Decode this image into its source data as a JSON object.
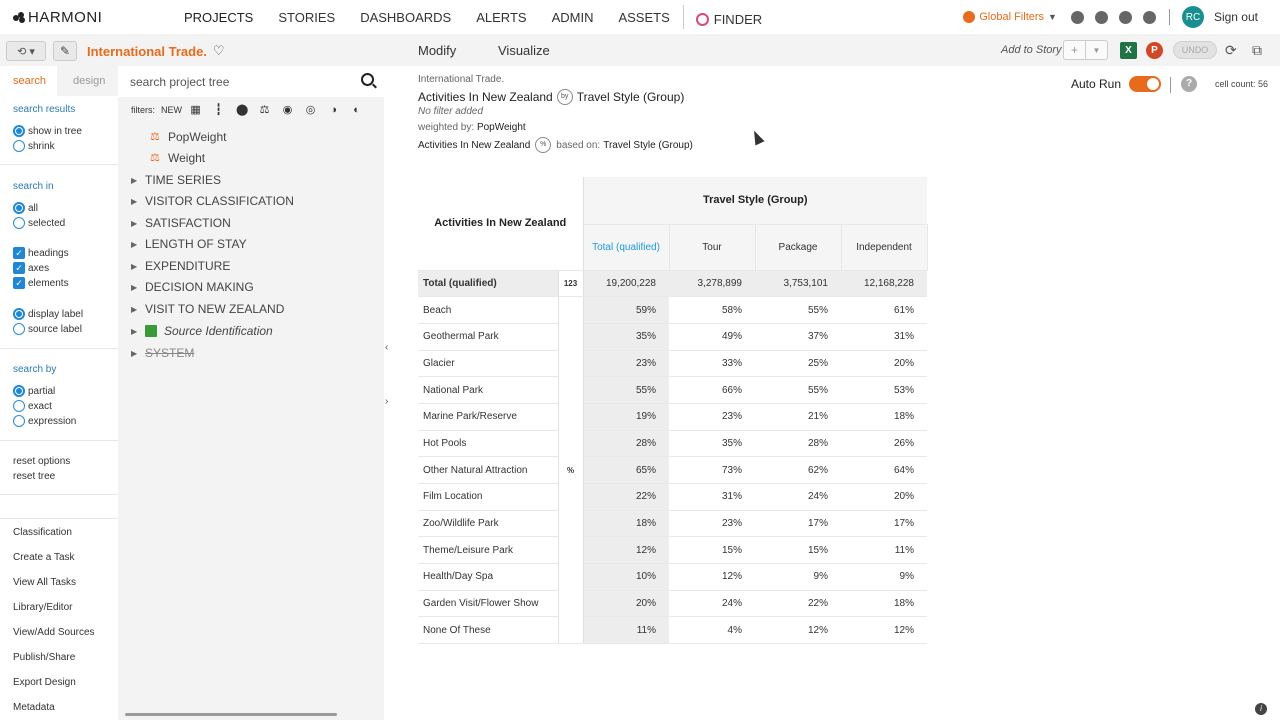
{
  "app": {
    "brand": "HARMONI",
    "nav": [
      "PROJECTS",
      "STORIES",
      "DASHBOARDS",
      "ALERTS",
      "ADMIN",
      "ASSETS"
    ],
    "finder": "FINDER",
    "global_filters": "Global Filters",
    "avatar_initials": "RC",
    "sign_out": "Sign out"
  },
  "subbar": {
    "project_title": "International Trade.",
    "modify": "Modify",
    "visualize": "Visualize",
    "add_to_story": "Add to Story",
    "undo": "UNDO",
    "excel": "X",
    "ppt": "P"
  },
  "left": {
    "tab_search": "search",
    "tab_design": "design",
    "search_results": "search results",
    "show_in_tree": "show in tree",
    "shrink": "shrink",
    "search_in": "search in",
    "all": "all",
    "selected": "selected",
    "headings": "headings",
    "axes": "axes",
    "elements": "elements",
    "display_label": "display label",
    "source_label": "source label",
    "search_by": "search by",
    "partial": "partial",
    "exact": "exact",
    "expression": "expression",
    "reset_options": "reset options",
    "reset_tree": "reset tree",
    "links": [
      "Classification",
      "Create a Task",
      "View All Tasks",
      "Library/Editor",
      "View/Add Sources",
      "Publish/Share",
      "Export Design",
      "Metadata"
    ]
  },
  "tree": {
    "search_placeholder": "search project tree",
    "filters_label": "filters:",
    "new": "NEW",
    "weights": [
      "PopWeight",
      "Weight"
    ],
    "folders": [
      "TIME SERIES",
      "VISITOR CLASSIFICATION",
      "SATISFACTION",
      "LENGTH OF STAY",
      "EXPENDITURE",
      "DECISION MAKING",
      "VISIT TO NEW ZEALAND"
    ],
    "source_identification": "Source Identification",
    "system": "SYSTEM"
  },
  "report": {
    "context": "International Trade.",
    "row_var": "Activities In New Zealand",
    "by": "by",
    "col_var": "Travel Style (Group)",
    "no_filter": "No filter added",
    "weighted_by_label": "weighted by:",
    "weighted_by": "PopWeight",
    "pct_icon": "%",
    "based_on_label": "based on:",
    "based_on": "Travel Style (Group)",
    "auto_run": "Auto Run",
    "help": "?",
    "cell_count": "cell count: 56"
  },
  "table": {
    "corner": "Activities In New Zealand",
    "col_group": "Travel Style (Group)",
    "columns": [
      "Total (qualified)",
      "Tour",
      "Package",
      "Independent"
    ],
    "total_label": "Total (qualified)",
    "total_unit": "123",
    "total_values": [
      "19,200,228",
      "3,278,899",
      "3,753,101",
      "12,168,228"
    ],
    "pct_unit": "%",
    "rows": [
      {
        "label": "Beach",
        "values": [
          "59%",
          "58%",
          "55%",
          "61%"
        ]
      },
      {
        "label": "Geothermal Park",
        "values": [
          "35%",
          "49%",
          "37%",
          "31%"
        ]
      },
      {
        "label": "Glacier",
        "values": [
          "23%",
          "33%",
          "25%",
          "20%"
        ]
      },
      {
        "label": "National Park",
        "values": [
          "55%",
          "66%",
          "55%",
          "53%"
        ]
      },
      {
        "label": "Marine Park/Reserve",
        "values": [
          "19%",
          "23%",
          "21%",
          "18%"
        ]
      },
      {
        "label": "Hot Pools",
        "values": [
          "28%",
          "35%",
          "28%",
          "26%"
        ]
      },
      {
        "label": "Other Natural Attraction",
        "values": [
          "65%",
          "73%",
          "62%",
          "64%"
        ]
      },
      {
        "label": "Film Location",
        "values": [
          "22%",
          "31%",
          "24%",
          "20%"
        ]
      },
      {
        "label": "Zoo/Wildlife Park",
        "values": [
          "18%",
          "23%",
          "17%",
          "17%"
        ]
      },
      {
        "label": "Theme/Leisure Park",
        "values": [
          "12%",
          "15%",
          "15%",
          "11%"
        ]
      },
      {
        "label": "Health/Day Spa",
        "values": [
          "10%",
          "12%",
          "9%",
          "9%"
        ]
      },
      {
        "label": "Garden Visit/Flower Show",
        "values": [
          "20%",
          "24%",
          "22%",
          "18%"
        ]
      },
      {
        "label": "None Of These",
        "values": [
          "11%",
          "4%",
          "12%",
          "12%"
        ]
      }
    ]
  },
  "colors": {
    "accent": "#e86a1c",
    "link": "#2a7ab8",
    "highlight": "#1e9ad8"
  }
}
